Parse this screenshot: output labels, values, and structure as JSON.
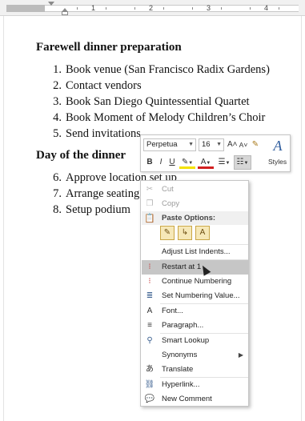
{
  "ruler": {
    "numbers": [
      "1",
      "2",
      "3",
      "4"
    ]
  },
  "document": {
    "heading1": "Farewell dinner preparation",
    "list1": [
      {
        "num": "1.",
        "text": "Book venue (San Francisco Radix Gardens)"
      },
      {
        "num": "2.",
        "text": "Contact vendors"
      },
      {
        "num": "3.",
        "text": "Book San Diego Quintessential Quartet"
      },
      {
        "num": "4.",
        "text": "Book Moment of Melody Children’s Choir"
      },
      {
        "num": "5.",
        "text": "Send invitations"
      }
    ],
    "heading2": "Day of the dinner",
    "list2": [
      {
        "num": "6.",
        "text": "Approve location set up"
      },
      {
        "num": "7.",
        "text": "Arrange seating"
      },
      {
        "num": "8.",
        "text": "Setup podium"
      }
    ]
  },
  "mini_toolbar": {
    "font_name": "Perpetua",
    "font_size": "16",
    "grow_font": "A˄",
    "shrink_font": "A˅",
    "bold": "B",
    "italic": "I",
    "underline": "U",
    "font_color": "A",
    "styles_label": "Styles"
  },
  "context_menu": {
    "cut": "Cut",
    "copy": "Copy",
    "paste_options": "Paste Options:",
    "adjust_list_indents": "Adjust List Indents...",
    "restart_at_1": "Restart at 1",
    "continue_numbering": "Continue Numbering",
    "set_numbering_value": "Set Numbering Value...",
    "font": "Font...",
    "paragraph": "Paragraph...",
    "smart_lookup": "Smart Lookup",
    "synonyms": "Synonyms",
    "translate": "Translate",
    "hyperlink": "Hyperlink...",
    "new_comment": "New Comment"
  },
  "colors": {
    "menu_highlight": "#c6c6c6",
    "icon_blue": "#3a5f8f"
  }
}
